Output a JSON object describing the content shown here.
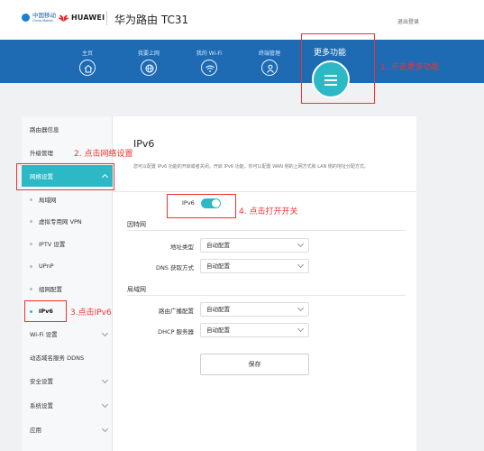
{
  "header": {
    "carrier_name": "中国移动",
    "carrier_sub": "China Mobile",
    "brand": "HUAWEI",
    "title": "华为路由 TC31",
    "logout": "退出登录"
  },
  "nav": {
    "items": [
      {
        "label": "主页",
        "icon": "home-icon"
      },
      {
        "label": "我要上网",
        "icon": "globe-icon"
      },
      {
        "label": "我的 Wi-Fi",
        "icon": "wifi-icon"
      },
      {
        "label": "终端管理",
        "icon": "user-icon"
      }
    ],
    "more_label": "更多功能",
    "more_icon": "menu-icon"
  },
  "annotations": {
    "step1": "1. 点击更多功能",
    "step2": "2. 点击网络设置",
    "step3": "3.点击IPv6",
    "step4": "4. 点击打开开关"
  },
  "sidebar": {
    "items": [
      {
        "label": "路由器信息"
      },
      {
        "label": "升级管理"
      },
      {
        "label": "网络设置"
      },
      {
        "label": "局域网"
      },
      {
        "label": "虚拟专用网 VPN"
      },
      {
        "label": "IPTV 设置"
      },
      {
        "label": "UPnP"
      },
      {
        "label": "组网配置"
      },
      {
        "label": "IPv6"
      },
      {
        "label": "Wi-Fi 设置"
      },
      {
        "label": "动态域名服务 DDNS"
      },
      {
        "label": "安全设置"
      },
      {
        "label": "系统设置"
      },
      {
        "label": "应用"
      }
    ]
  },
  "main": {
    "title": "IPv6",
    "description": "您可以配置 IPv6 功能的开启或者关闭。开启 IPv6 功能，你可以配置 WAN 侧的上网方式和 LAN 侧的地址分配方式。",
    "toggle_label": "IPv6",
    "toggle_on": true,
    "accent_color": "#2cb9c5",
    "internet": {
      "heading": "因特网",
      "fields": [
        {
          "label": "地址类型",
          "value": "自动配置"
        },
        {
          "label": "DNS 获取方式",
          "value": "自动配置"
        }
      ]
    },
    "lan": {
      "heading": "局域网",
      "fields": [
        {
          "label": "路由广播配置",
          "value": "自动配置"
        },
        {
          "label": "DHCP 服务器",
          "value": "自动配置"
        }
      ]
    },
    "save_label": "保存"
  }
}
